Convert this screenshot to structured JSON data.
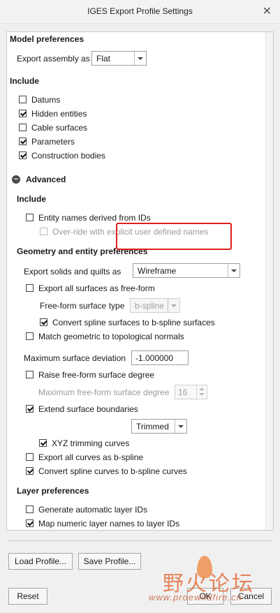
{
  "window": {
    "title": "IGES Export Profile Settings",
    "close_glyph": "✕"
  },
  "model_preferences": {
    "header": "Model preferences",
    "export_assembly_label": "Export assembly as",
    "export_assembly_value": "Flat"
  },
  "include": {
    "header": "Include",
    "items": [
      {
        "label": "Datums",
        "checked": false
      },
      {
        "label": "Hidden entities",
        "checked": true
      },
      {
        "label": "Cable surfaces",
        "checked": false
      },
      {
        "label": "Parameters",
        "checked": true
      },
      {
        "label": "Construction bodies",
        "checked": true
      }
    ]
  },
  "advanced": {
    "header": "Advanced",
    "toggle_glyph": "−",
    "include_header": "Include",
    "entity_names": "Entity names derived from IDs",
    "override_names": "Over-ride with explicit user defined names",
    "geometry_header": "Geometry and entity preferences",
    "export_solids_label": "Export solids and quilts as",
    "export_solids_value": "Wireframe",
    "export_freeform": "Export all surfaces as free-form",
    "freeform_type_label": "Free-form surface type",
    "freeform_type_value": "b-spline",
    "convert_spline_surfaces": "Convert spline surfaces to b-spline surfaces",
    "match_geometric": "Match geometric to topological normals",
    "max_deviation_label": "Maximum surface deviation",
    "max_deviation_value": "-1.000000",
    "raise_degree": "Raise free-form surface degree",
    "max_degree_label": "Maximum free-form surface degree",
    "max_degree_value": "16",
    "extend_boundaries": "Extend surface boundaries",
    "trimmed_value": "Trimmed",
    "xyz_trimming": "XYZ trimming curves",
    "export_curves_bspline": "Export all curves as b-spline",
    "convert_spline_curves": "Convert spline curves to b-spline curves",
    "layer_header": "Layer preferences",
    "generate_layer_ids": "Generate automatic layer IDs",
    "map_layer_names": "Map numeric layer names to layer IDs"
  },
  "buttons": {
    "load_profile": "Load Profile...",
    "save_profile": "Save Profile...",
    "reset": "Reset",
    "ok": "OK",
    "cancel": "Cancel"
  },
  "watermark": {
    "text": "野火论坛",
    "url": "www.proewildfire.cn"
  },
  "colors": {
    "highlight_box": "#e0201c",
    "watermark": "#e0622a"
  }
}
